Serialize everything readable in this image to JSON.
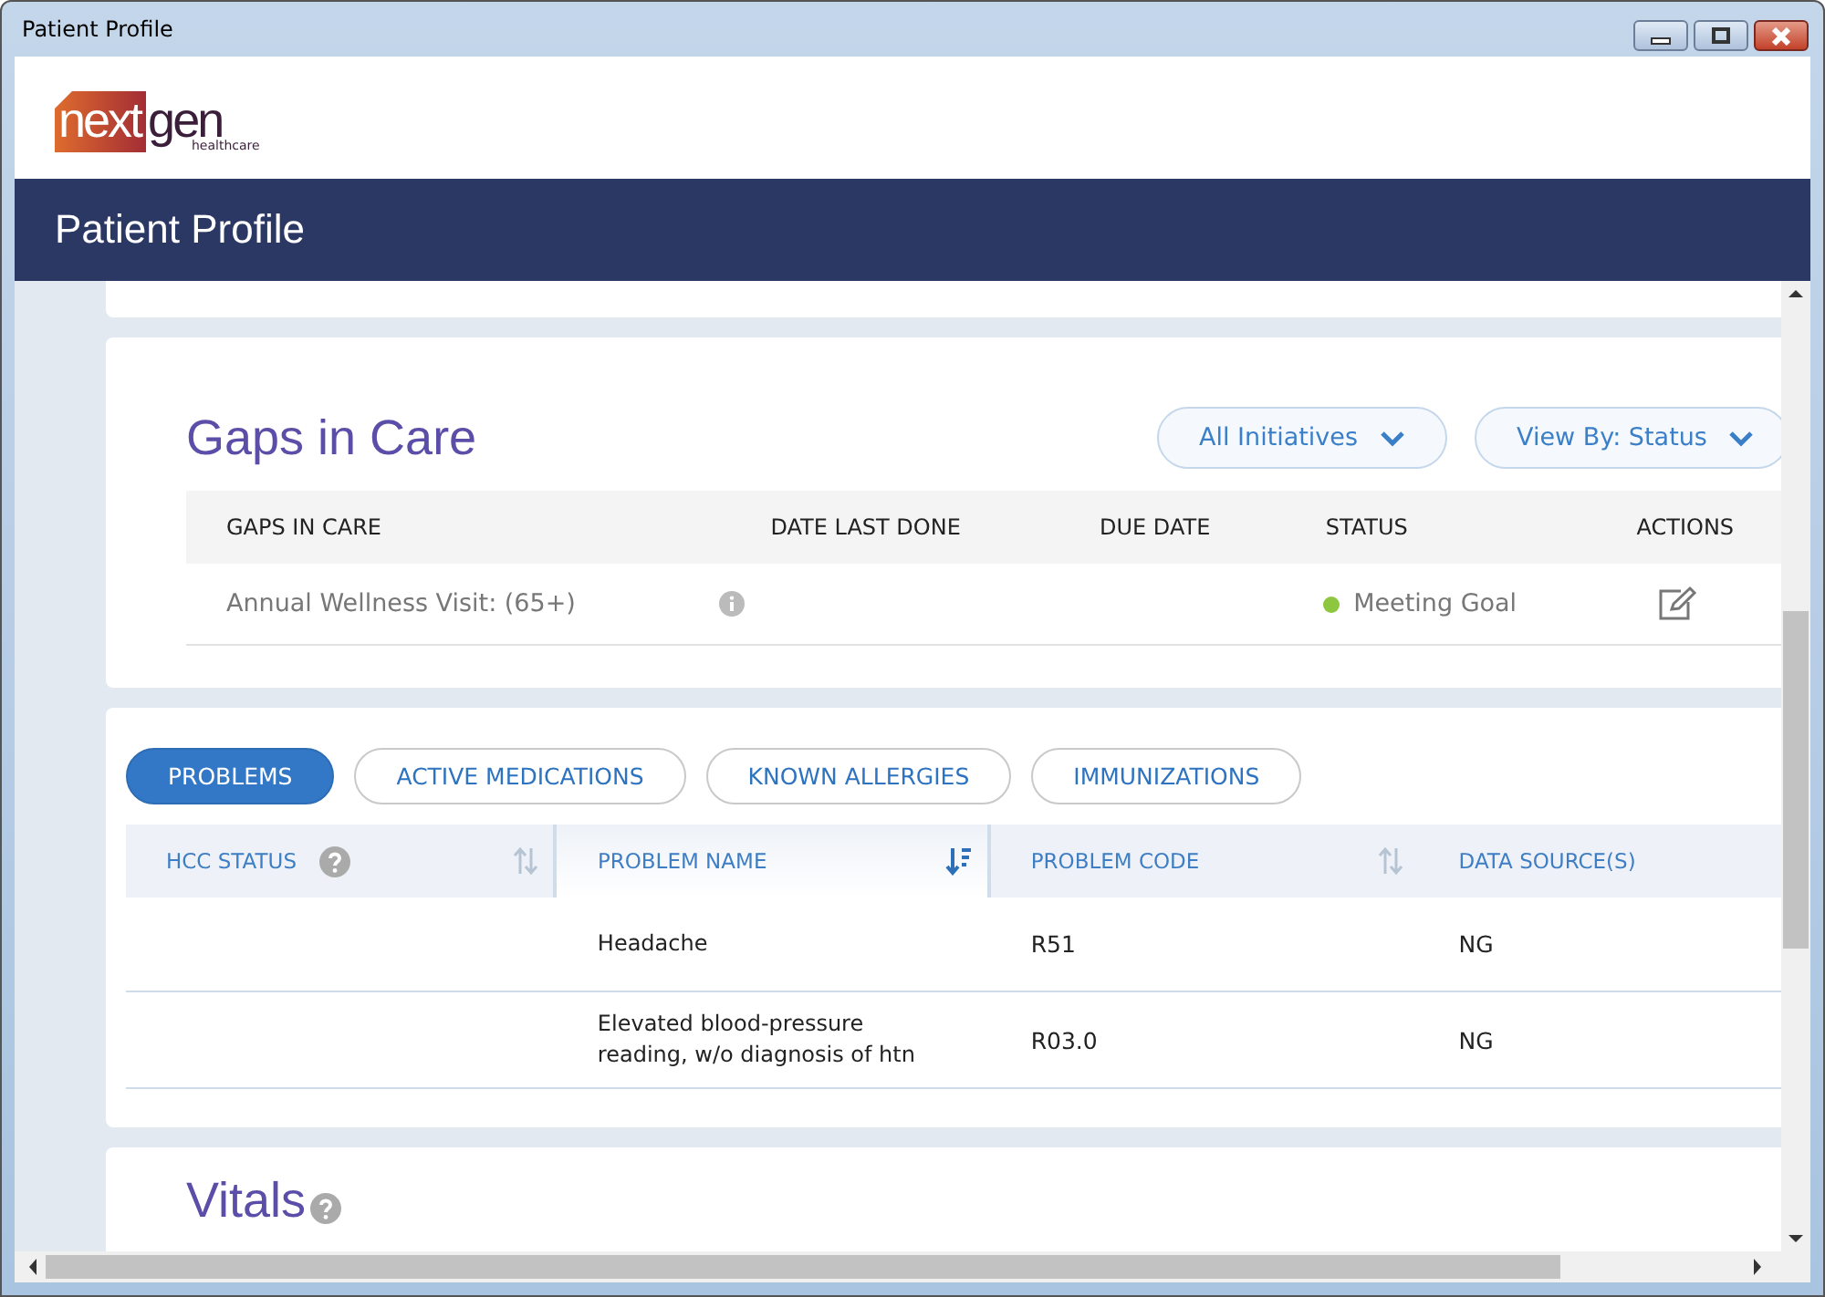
{
  "window": {
    "title": "Patient Profile"
  },
  "logo": {
    "wordmark_first": "next",
    "wordmark_second": "gen",
    "tagline": "healthcare"
  },
  "header": {
    "title": "Patient Profile"
  },
  "gaps": {
    "title": "Gaps in Care",
    "filters": [
      "All Initiatives",
      "View By: Status"
    ],
    "columns": [
      "GAPS IN CARE",
      "DATE LAST DONE",
      "DUE DATE",
      "STATUS",
      "ACTIONS"
    ],
    "rows": [
      {
        "name": "Annual Wellness Visit: (65+)",
        "date_last_done": "",
        "due_date": "",
        "status": "Meeting Goal",
        "color": "#8dc63f"
      }
    ]
  },
  "problems": {
    "tabs": [
      {
        "label": "PROBLEMS",
        "selected": true
      },
      {
        "label": "ACTIVE MEDICATIONS",
        "selected": false
      },
      {
        "label": "KNOWN ALLERGIES",
        "selected": false
      },
      {
        "label": "IMMUNIZATIONS",
        "selected": false
      }
    ],
    "columns": [
      {
        "label": "HCC STATUS",
        "kind": "help_sortable",
        "sort_active": false
      },
      {
        "label": "PROBLEM NAME",
        "kind": "sortable",
        "sort_active": true
      },
      {
        "label": "PROBLEM CODE",
        "kind": "sortable",
        "sort_active": false
      },
      {
        "label": "DATA SOURCE(S)",
        "kind": "plain"
      }
    ],
    "rows": [
      {
        "name": "Headache",
        "code": "R51",
        "source": "NG"
      },
      {
        "name": "Elevated blood-pressure reading, w/o diagnosis of htn",
        "code": "R03.0",
        "source": "NG"
      }
    ]
  },
  "vitals": {
    "title": "Vitals"
  }
}
